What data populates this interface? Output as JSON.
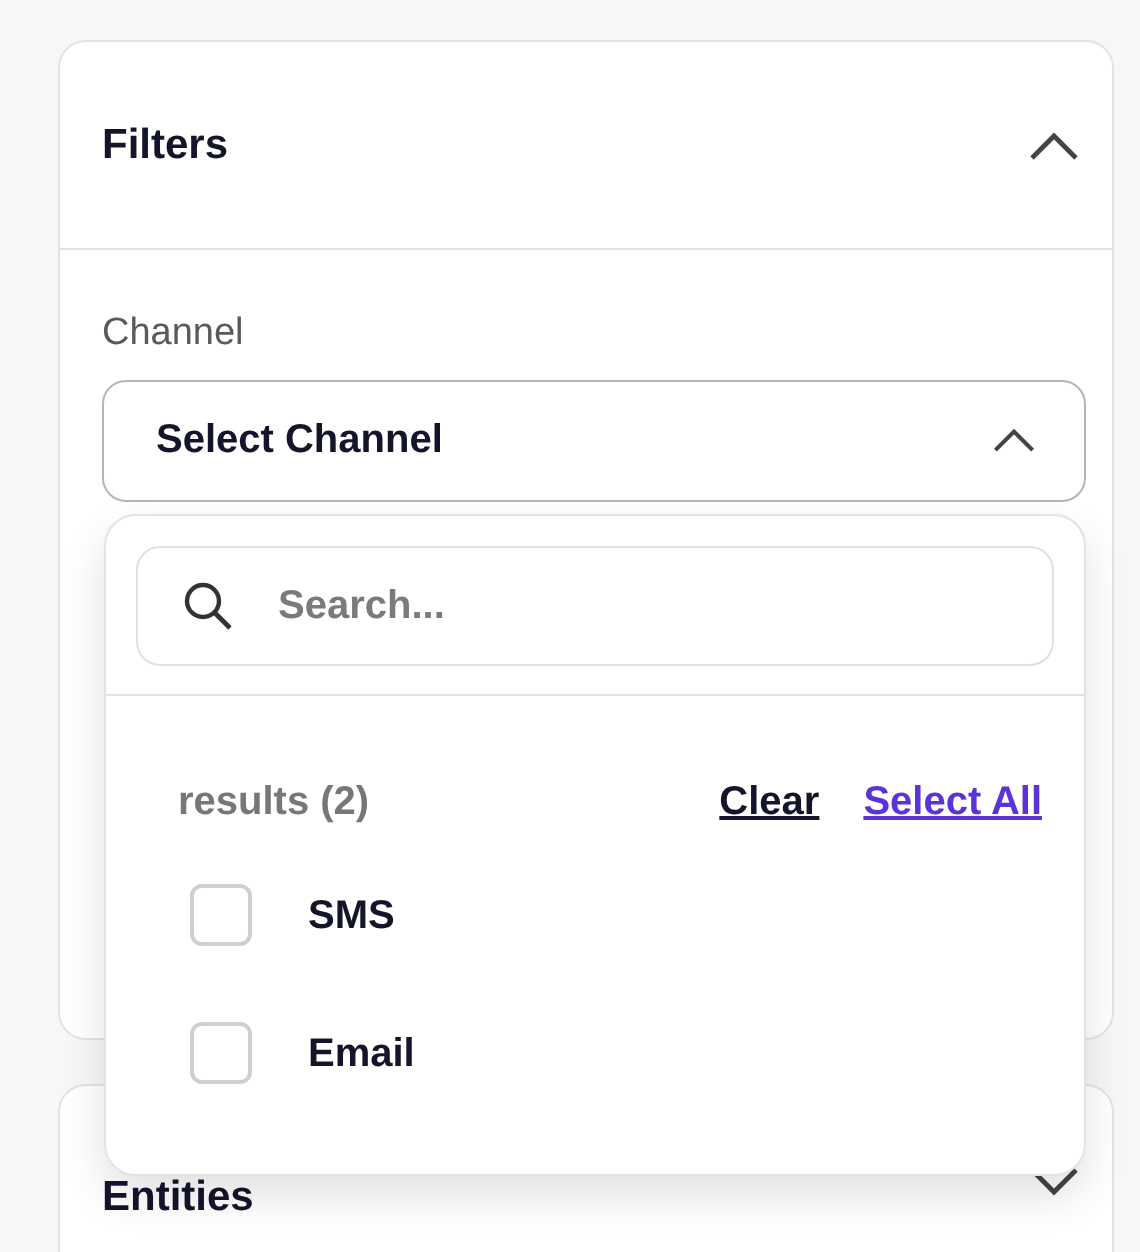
{
  "filters": {
    "title": "Filters",
    "expanded": true,
    "channel": {
      "label": "Channel",
      "text": "Select Channel",
      "open": true,
      "dropdown": {
        "search_placeholder": "Search...",
        "results_label": "results (2)",
        "actions": [
          {
            "label": "Clear",
            "kind": "clear"
          },
          {
            "label": "Select All",
            "kind": "select_all"
          }
        ],
        "options": [
          {
            "label": "SMS",
            "checked": false
          },
          {
            "label": "Email",
            "checked": false
          }
        ]
      }
    }
  },
  "entities": {
    "title": "Entities",
    "expanded": false
  }
}
